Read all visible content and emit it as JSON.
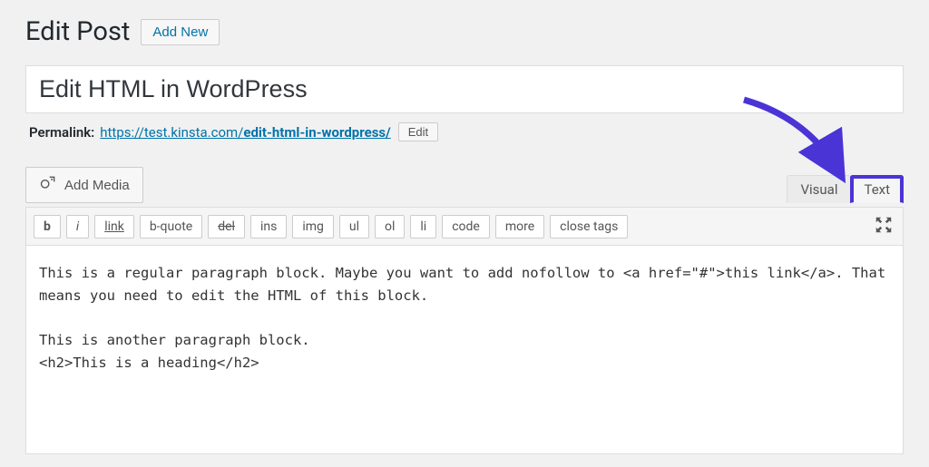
{
  "header": {
    "title": "Edit Post",
    "add_new": "Add New"
  },
  "post": {
    "title": "Edit HTML in WordPress",
    "permalink_label": "Permalink:",
    "permalink_base": "https://test.kinsta.com/",
    "permalink_slug": "edit-html-in-wordpress/",
    "permalink_edit": "Edit"
  },
  "media": {
    "add_media": "Add Media"
  },
  "tabs": {
    "visual": "Visual",
    "text": "Text",
    "active": "text"
  },
  "quicktags": {
    "b": "b",
    "i": "i",
    "link": "link",
    "bquote": "b-quote",
    "del": "del",
    "ins": "ins",
    "img": "img",
    "ul": "ul",
    "ol": "ol",
    "li": "li",
    "code": "code",
    "more": "more",
    "close": "close tags"
  },
  "editor": {
    "content": "This is a regular paragraph block. Maybe you want to add nofollow to <a href=\"#\">this link</a>. That means you need to edit the HTML of this block.\n\nThis is another paragraph block.\n<h2>This is a heading</h2>"
  },
  "annotation": {
    "color": "#4a34d6"
  }
}
